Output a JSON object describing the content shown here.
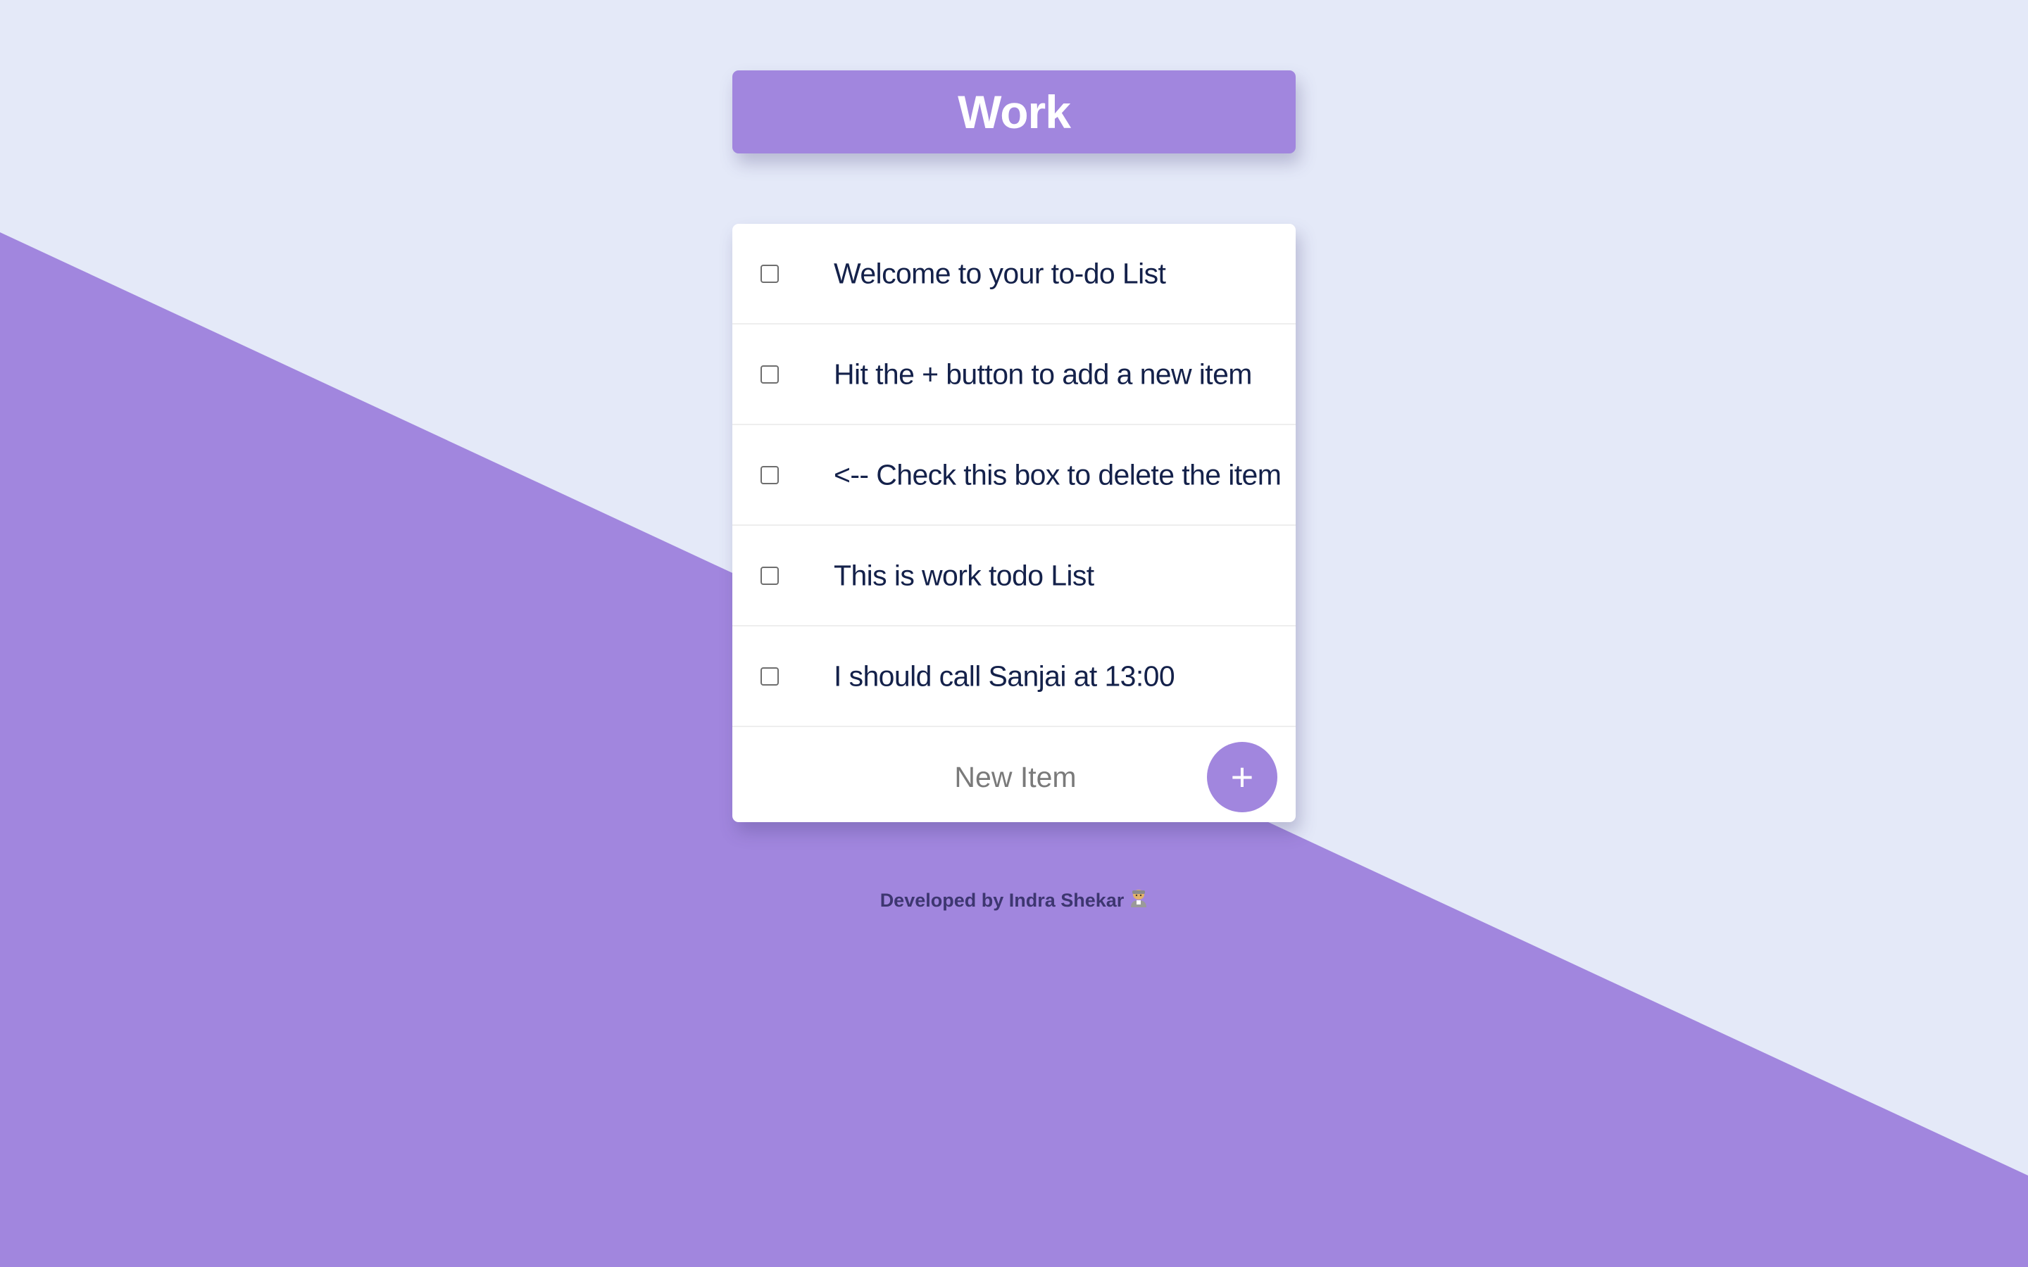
{
  "header": {
    "title": "Work"
  },
  "todo": {
    "items": [
      {
        "label": "Welcome to your to-do List"
      },
      {
        "label": "Hit the + button to add a new item"
      },
      {
        "label": "<-- Check this box to delete the item"
      },
      {
        "label": "This is work todo List"
      },
      {
        "label": "I should call Sanjai at 13:00"
      }
    ],
    "new_item_placeholder": "New Item",
    "add_button_label": "+"
  },
  "footer": {
    "text": "Developed by Indra Shekar"
  },
  "colors": {
    "accent": "#A186DE",
    "background": "#E4E9F8",
    "text": "#14214A"
  }
}
